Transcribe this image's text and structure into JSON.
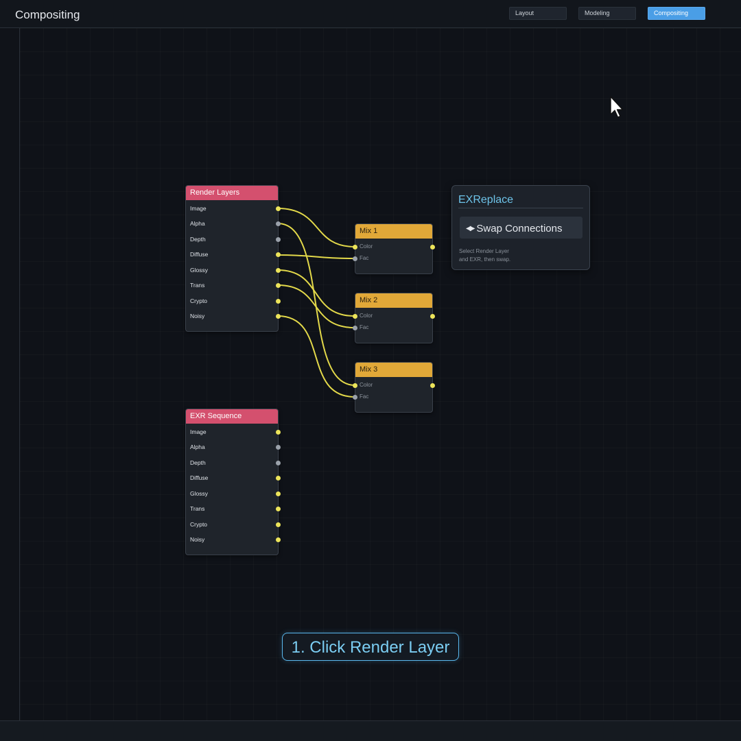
{
  "app": {
    "title": "Compositing"
  },
  "workspaces": [
    {
      "label": "Layout",
      "active": false
    },
    {
      "label": "Modeling",
      "active": false
    },
    {
      "label": "Compositing",
      "active": true
    }
  ],
  "nodes": {
    "render_layers": {
      "title": "Render Layers",
      "outputs": [
        "Image",
        "Alpha",
        "Depth",
        "Diffuse",
        "Glossy",
        "Trans",
        "Crypto",
        "Noisy"
      ]
    },
    "exr_sequence": {
      "title": "EXR Sequence",
      "outputs": [
        "Image",
        "Alpha",
        "Depth",
        "Diffuse",
        "Glossy",
        "Trans",
        "Crypto",
        "Noisy"
      ]
    },
    "mix_nodes": [
      {
        "title": "Mix 1",
        "inputs": [
          "Color",
          "Fac"
        ]
      },
      {
        "title": "Mix 2",
        "inputs": [
          "Color",
          "Fac"
        ]
      },
      {
        "title": "Mix 3",
        "inputs": [
          "Color",
          "Fac"
        ]
      }
    ]
  },
  "panel": {
    "title": "EXReplace",
    "swap_icon": "swap-arrows-icon",
    "swap_label": "Swap Connections",
    "hint_line1": "Select Render Layer",
    "hint_line2": "and EXR, then swap."
  },
  "callout": {
    "text": "1. Click Render Layer"
  },
  "colors": {
    "source_header": "#d4506e",
    "mix_header": "#e1a838",
    "wire": "#e3d94a",
    "accent": "#4a9ee6",
    "socket_yellow": "#ece45a",
    "socket_gray": "#9aa1aa"
  }
}
